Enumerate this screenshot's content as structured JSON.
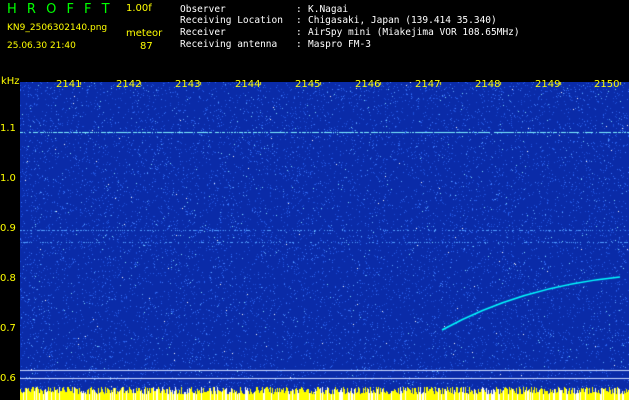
{
  "header": {
    "app_title": "HROFFT",
    "version": "1.00f",
    "filename": "KN9_2506302140.png",
    "mode": "meteor",
    "datetime": "25.06.30 21:40",
    "count": "87"
  },
  "info": [
    {
      "label": "Observer",
      "value": "K.Nagai"
    },
    {
      "label": "Receiving Location",
      "value": "Chigasaki, Japan (139.414 35.340)"
    },
    {
      "label": "Receiver",
      "value": "AirSpy mini (Miakejima VOR 108.65MHz)"
    },
    {
      "label": "Receiving antenna",
      "value": "Maspro FM-3"
    }
  ],
  "info_sep": ":",
  "spectrogram": {
    "unit_label": "kHz",
    "time_ticks": [
      "2141",
      "2142",
      "2143",
      "2144",
      "2145",
      "2146",
      "2147",
      "2148",
      "2149",
      "2150"
    ],
    "freq_labels": [
      "1.1",
      "1.0",
      "0.9",
      "0.8",
      "0.7",
      "0.6"
    ],
    "background_color": "#0a2ba8",
    "signal_color": "#00ffff"
  }
}
